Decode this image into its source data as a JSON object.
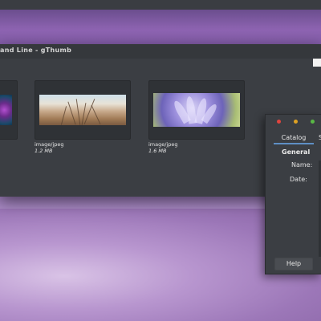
{
  "window": {
    "title": "and Line - gThumb"
  },
  "thumbnails": [
    {
      "type": "",
      "size": ""
    },
    {
      "type": "image/jpeg",
      "size": "1.2 MB"
    },
    {
      "type": "image/jpeg",
      "size": "1.6 MB"
    }
  ],
  "side_panel": {
    "traffic_lights": [
      "#e0443e",
      "#dea123",
      "#59b845"
    ],
    "tabs": [
      "Catalog",
      "S"
    ],
    "section_header": "General",
    "fields": [
      "Name:",
      "Date:"
    ],
    "help_label": "Help"
  }
}
